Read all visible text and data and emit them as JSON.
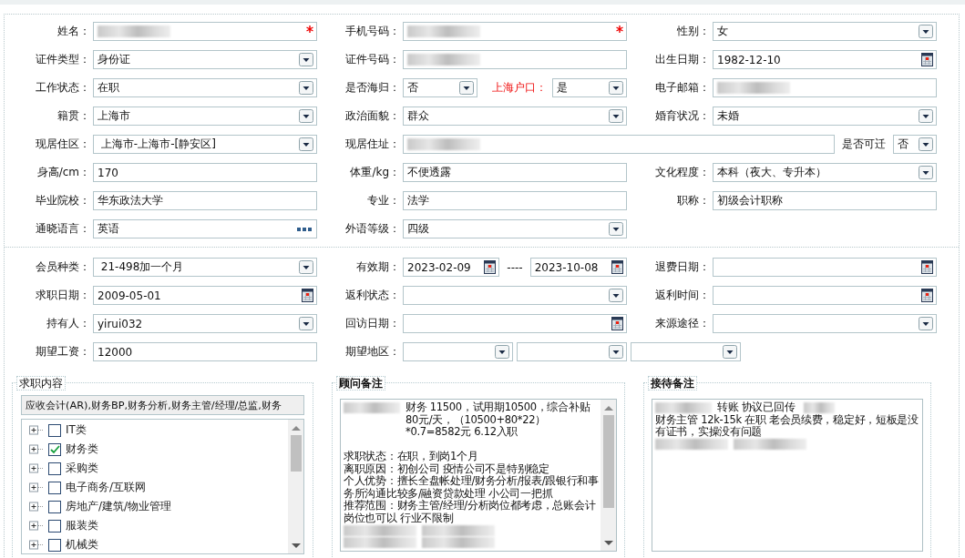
{
  "sections": [
    {
      "rows": [
        {
          "cells": [
            {
              "label": "姓名：",
              "parts": [
                {
                  "kind": "text",
                  "blurred": true,
                  "required": true
                }
              ]
            },
            {
              "label": "手机号码：",
              "parts": [
                {
                  "kind": "text",
                  "blurred": true,
                  "required": true
                }
              ]
            },
            {
              "label": "性别：",
              "parts": [
                {
                  "kind": "select",
                  "value": "女"
                }
              ]
            }
          ]
        },
        {
          "cells": [
            {
              "label": "证件类型：",
              "parts": [
                {
                  "kind": "select",
                  "value": "身份证"
                }
              ]
            },
            {
              "label": "证件号码：",
              "parts": [
                {
                  "kind": "text",
                  "blurred": true
                }
              ]
            },
            {
              "label": "出生日期：",
              "parts": [
                {
                  "kind": "date",
                  "value": "1982-12-10"
                }
              ]
            }
          ]
        },
        {
          "cells": [
            {
              "label": "工作状态：",
              "parts": [
                {
                  "kind": "select",
                  "value": "在职"
                }
              ]
            },
            {
              "label": "是否海归：",
              "parts": [
                {
                  "kind": "select",
                  "value": "否"
                },
                {
                  "kind": "label",
                  "text": "上海户口：",
                  "alert": true
                },
                {
                  "kind": "select",
                  "value": "是"
                }
              ]
            },
            {
              "label": "电子邮箱：",
              "parts": [
                {
                  "kind": "text",
                  "blurred": true
                }
              ]
            }
          ]
        },
        {
          "cells": [
            {
              "label": "籍贯：",
              "parts": [
                {
                  "kind": "select",
                  "value": "上海市"
                }
              ]
            },
            {
              "label": "政治面貌：",
              "parts": [
                {
                  "kind": "select",
                  "value": "群众"
                }
              ]
            },
            {
              "label": "婚育状况：",
              "parts": [
                {
                  "kind": "select",
                  "value": "未婚"
                }
              ]
            }
          ]
        },
        {
          "cells": [
            {
              "label": "现居住区：",
              "parts": [
                {
                  "kind": "select",
                  "value": " 上海市-上海市-[静安区]"
                }
              ]
            },
            {
              "label": "现居住址：",
              "parts": [
                {
                  "kind": "text",
                  "blurred": true
                },
                {
                  "kind": "label",
                  "text": "是否可迁",
                  "alert": false
                },
                {
                  "kind": "select",
                  "value": "否"
                }
              ]
            }
          ]
        },
        {
          "cells": [
            {
              "label": "身高/cm：",
              "parts": [
                {
                  "kind": "text",
                  "value": "170"
                }
              ]
            },
            {
              "label": "体重/kg：",
              "parts": [
                {
                  "kind": "text",
                  "value": "不便透露"
                }
              ]
            },
            {
              "label": "文化程度：",
              "parts": [
                {
                  "kind": "select",
                  "value": "本科（夜大、专升本）"
                }
              ]
            }
          ]
        },
        {
          "cells": [
            {
              "label": "毕业院校：",
              "parts": [
                {
                  "kind": "text",
                  "value": "华东政法大学"
                }
              ]
            },
            {
              "label": "专业：",
              "parts": [
                {
                  "kind": "text",
                  "value": "法学"
                }
              ]
            },
            {
              "label": "职称：",
              "parts": [
                {
                  "kind": "text",
                  "value": "初级会计职称"
                }
              ]
            }
          ]
        },
        {
          "cells": [
            {
              "label": "通晓语言：",
              "parts": [
                {
                  "kind": "picker",
                  "value": "英语"
                }
              ]
            },
            {
              "label": "外语等级：",
              "parts": [
                {
                  "kind": "select",
                  "value": "四级"
                }
              ]
            }
          ]
        }
      ]
    },
    {
      "rows": [
        {
          "cells": [
            {
              "label": "会员种类：",
              "parts": [
                {
                  "kind": "select",
                  "value": " 21-498加一个月"
                }
              ]
            },
            {
              "label": "有效期：",
              "parts": [
                {
                  "kind": "date",
                  "value": "2023-02-09"
                },
                {
                  "kind": "label",
                  "text": "----",
                  "alert": false
                },
                {
                  "kind": "date",
                  "value": "2023-10-08"
                }
              ]
            },
            {
              "label": "退费日期：",
              "parts": [
                {
                  "kind": "date"
                }
              ]
            }
          ]
        },
        {
          "cells": [
            {
              "label": "求职日期：",
              "parts": [
                {
                  "kind": "date",
                  "value": "2009-05-01"
                }
              ]
            },
            {
              "label": "返利状态：",
              "parts": [
                {
                  "kind": "select"
                }
              ]
            },
            {
              "label": "返利时间：",
              "parts": [
                {
                  "kind": "date"
                }
              ]
            }
          ]
        },
        {
          "cells": [
            {
              "label": "持有人：",
              "parts": [
                {
                  "kind": "select",
                  "value": "yirui032"
                }
              ]
            },
            {
              "label": "回访日期：",
              "parts": [
                {
                  "kind": "date"
                }
              ]
            },
            {
              "label": "来源途径：",
              "parts": [
                {
                  "kind": "select"
                }
              ]
            }
          ]
        },
        {
          "cells": [
            {
              "label": "期望工资：",
              "parts": [
                {
                  "kind": "text",
                  "value": "12000"
                }
              ]
            },
            {
              "label": "期望地区：",
              "parts": [
                {
                  "kind": "select"
                },
                {
                  "kind": "select"
                },
                {
                  "kind": "select"
                }
              ]
            }
          ]
        }
      ]
    }
  ],
  "job_interest": {
    "title": "求职内容",
    "summary": "应收会计(AR),财务BP,财务分析,财务主管/经理/总监,财务",
    "categories": [
      {
        "label": "IT类",
        "checked": false,
        "expanded": false
      },
      {
        "label": "财务类",
        "checked": true,
        "expanded": false
      },
      {
        "label": "采购类",
        "checked": false,
        "expanded": false
      },
      {
        "label": "电子商务/互联网",
        "checked": false,
        "expanded": false
      },
      {
        "label": "房地产/建筑/物业管理",
        "checked": false,
        "expanded": false
      },
      {
        "label": "服装类",
        "checked": false,
        "expanded": false
      },
      {
        "label": "机械类",
        "checked": false,
        "expanded": false
      }
    ]
  },
  "notes": [
    {
      "title": "顾问备注",
      "scrollbar": true,
      "paragraphs": [
        {
          "kind": "text",
          "blurred_before": true,
          "text": "财务 11500，试用期10500，综合补贴80元/天，（10500+80*22）*0.7=8582元  6.12入职"
        },
        {
          "kind": "blank"
        },
        {
          "kind": "text",
          "text": "求职状态：在职，到岗1个月"
        },
        {
          "kind": "text",
          "text": "离职原因：初创公司 疫情公司不是特别稳定"
        },
        {
          "kind": "text",
          "text": "个人优势：擅长全盘帐处理/财务分析/报表/跟银行和事务所沟通比较多/融资贷款处理 小公司一把抓"
        },
        {
          "kind": "text",
          "text": "推荐范围：财务主管/经理/分析岗位都考虑，总账会计岗位也可以 行业不限制"
        },
        {
          "kind": "blurred"
        },
        {
          "kind": "blurred"
        }
      ]
    },
    {
      "title": "接待备注",
      "scrollbar": false,
      "paragraphs": [
        {
          "kind": "text",
          "blurred_before": true,
          "blurred_after": true,
          "text": "转账 协议已回传"
        },
        {
          "kind": "text",
          "text": "财务主管 12k-15k 在职 老会员续费，稳定好，短板是没有证书，实操没有问题"
        },
        {
          "kind": "blurred"
        }
      ]
    }
  ]
}
